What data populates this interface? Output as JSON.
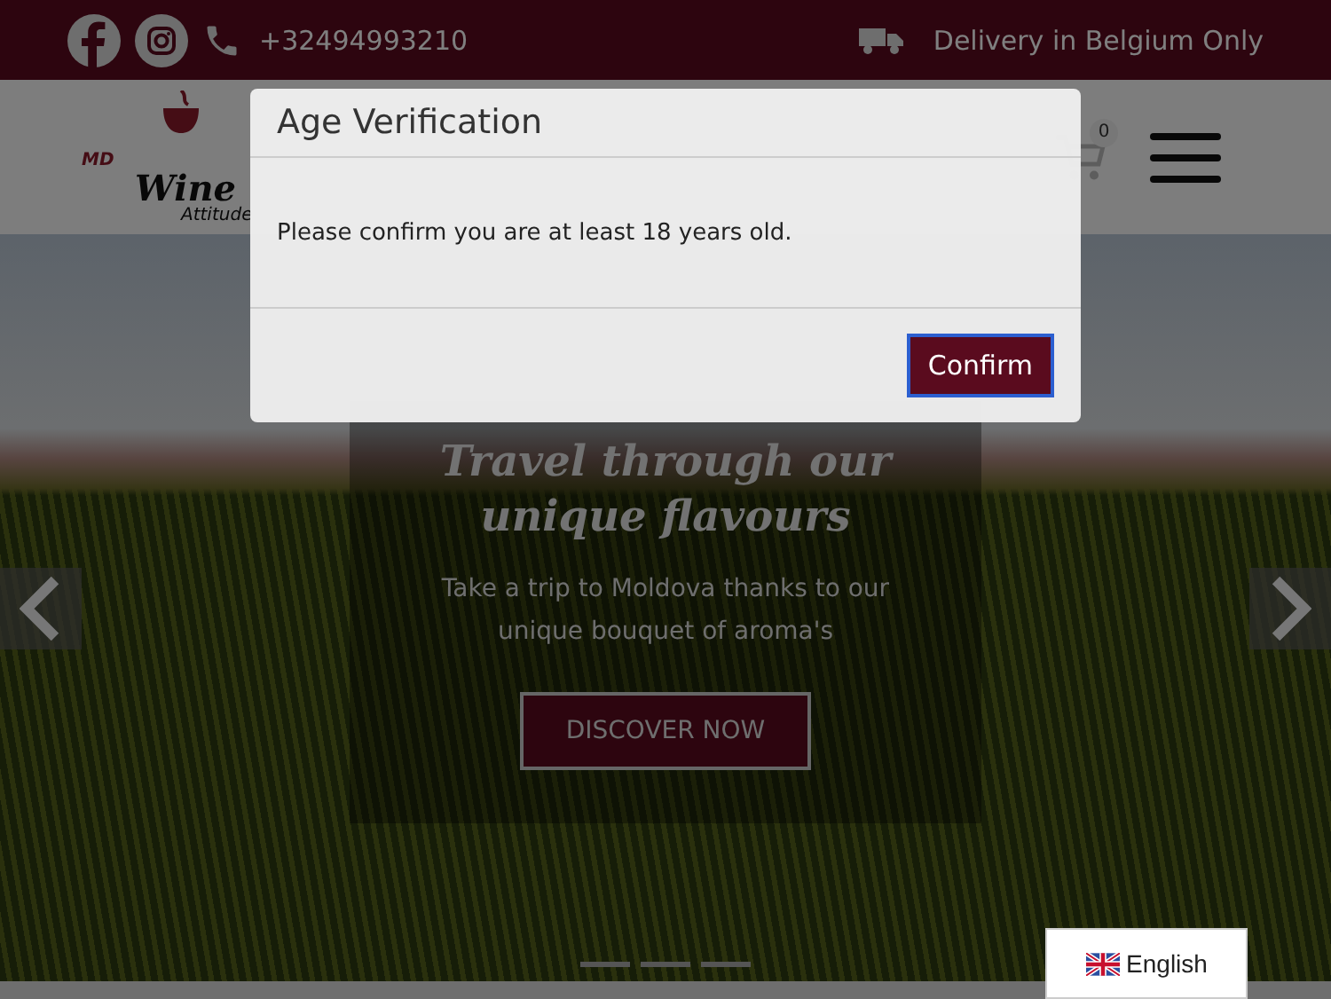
{
  "top_bar": {
    "phone": "+32494993210",
    "delivery": "Delivery in Belgium Only"
  },
  "header": {
    "logo": {
      "mark": "MD",
      "name": "Wine",
      "tagline": "Attitude"
    },
    "cart_count": "0"
  },
  "hero": {
    "title": "Travel through our unique flavours",
    "text": "Take a trip to Moldova thanks to our unique bouquet of aroma's",
    "button": "DISCOVER NOW",
    "slides": [
      {
        "selected": false
      },
      {
        "selected": false
      },
      {
        "selected": false
      }
    ]
  },
  "modal": {
    "title": "Age Verification",
    "message": "Please confirm you are at least 18 years old.",
    "button": "Confirm"
  },
  "language": {
    "label": "English"
  }
}
